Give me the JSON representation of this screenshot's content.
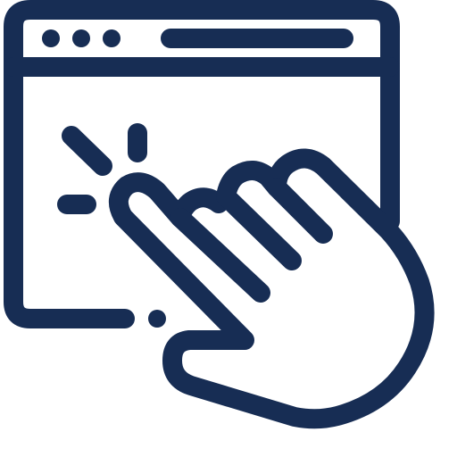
{
  "icon": {
    "name": "browser-click-icon",
    "parts": [
      "browser-window-icon",
      "pointing-hand-icon",
      "click-burst-icon"
    ]
  },
  "colors": {
    "stroke": "#172D54",
    "background": "#FFFFFF",
    "fill": "#FFFFFF"
  }
}
